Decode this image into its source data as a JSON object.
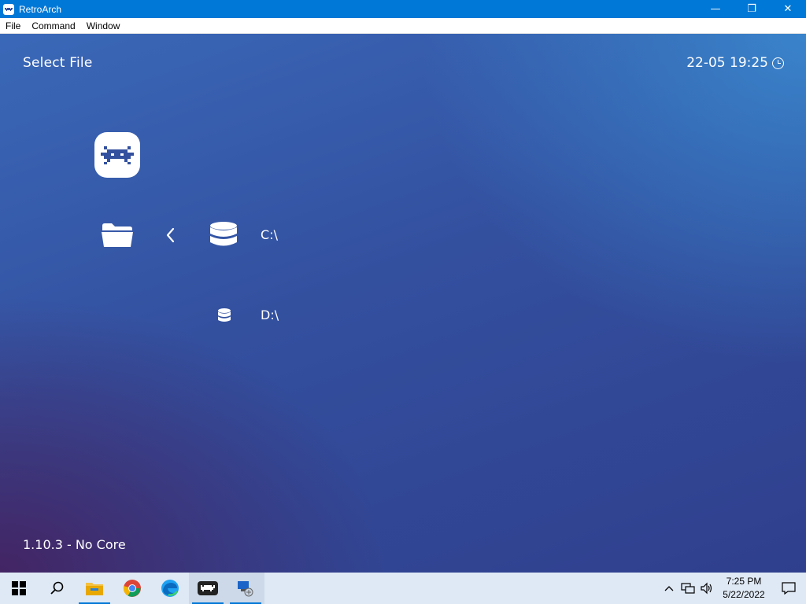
{
  "window": {
    "title": "RetroArch",
    "minimize_glyph": "—",
    "maximize_glyph": "❐",
    "close_glyph": "✕"
  },
  "menu": {
    "items": [
      "File",
      "Command",
      "Window"
    ]
  },
  "header": {
    "title": "Select File",
    "clock": "22-05 19:25"
  },
  "file_browser": {
    "entries": [
      {
        "label": "C:\\",
        "icon": "drive-icon",
        "selected": true
      },
      {
        "label": "D:\\",
        "icon": "drive-icon",
        "selected": false
      }
    ],
    "sidebar_icon": "folder-icon",
    "back_icon": "chevron-left-icon"
  },
  "footer": {
    "version": "1.10.3 - No Core"
  },
  "taskbar": {
    "apps": [
      "start-icon",
      "search-icon",
      "file-explorer-icon",
      "chrome-icon",
      "edge-icon",
      "retroarch-icon",
      "network-app-icon"
    ],
    "tray": {
      "time": "7:25 PM",
      "date": "5/22/2022"
    }
  },
  "colors": {
    "titlebar": "#0078d7",
    "background_top": "#3a8cd2",
    "background_bottom": "#461e5a"
  }
}
